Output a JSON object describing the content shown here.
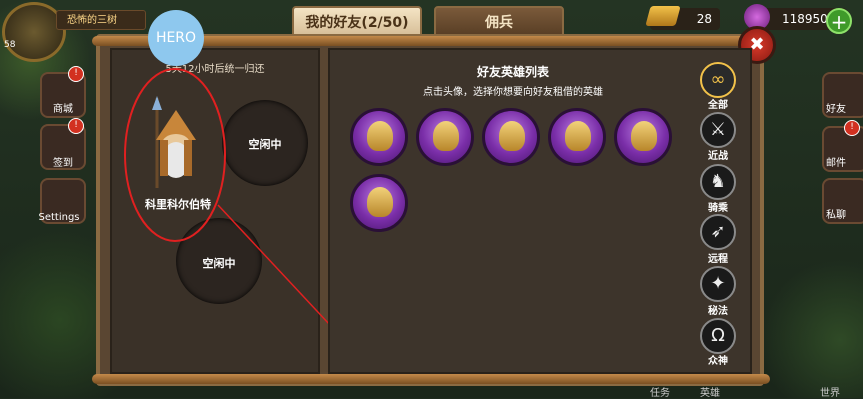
{
  "hud": {
    "level": "58",
    "player_title": "恐怖的三树",
    "gold": "28",
    "gems": "118950",
    "plus": "+"
  },
  "left_menu": [
    {
      "label": "商城",
      "badge": "!"
    },
    {
      "label": "签到",
      "badge": "!"
    },
    {
      "label": "Settings",
      "badge": ""
    }
  ],
  "right_menu": [
    {
      "label": "好友"
    },
    {
      "label": "邮件",
      "badge": "!"
    },
    {
      "label": "私聊"
    }
  ],
  "tabs": [
    {
      "label": "我的好友(2/50)"
    },
    {
      "label": "佣兵"
    }
  ],
  "annotation": {
    "bubble": "HERO"
  },
  "slots": {
    "timer": "5天12小时后统一归还",
    "hero_name": "科里科尔伯特",
    "empty_1": "空闲中",
    "empty_2": "空闲中"
  },
  "list": {
    "title": "好友英雄列表",
    "subtitle": "点击头像，选择你想要向好友租借的英雄",
    "heroes": [
      "hero-1",
      "hero-2",
      "hero-3",
      "hero-4",
      "hero-5",
      "hero-6"
    ]
  },
  "filters": [
    {
      "label": "全部",
      "icon": "infinity-icon",
      "glyph": "∞"
    },
    {
      "label": "近战",
      "icon": "sword-icon",
      "glyph": "⚔"
    },
    {
      "label": "骑乘",
      "icon": "horse-icon",
      "glyph": "♞"
    },
    {
      "label": "远程",
      "icon": "bow-icon",
      "glyph": "➶"
    },
    {
      "label": "秘法",
      "icon": "magic-icon",
      "glyph": "✦"
    },
    {
      "label": "众神",
      "icon": "omega-icon",
      "glyph": "Ω"
    }
  ],
  "close": "✖",
  "bottom": {
    "world": "世界",
    "b1": "任务",
    "b2": "英雄"
  },
  "colors": {
    "accent_annotation": "#e02020",
    "tab_active": "#f4e4c4",
    "hero_purple": "#7a2ea8"
  }
}
